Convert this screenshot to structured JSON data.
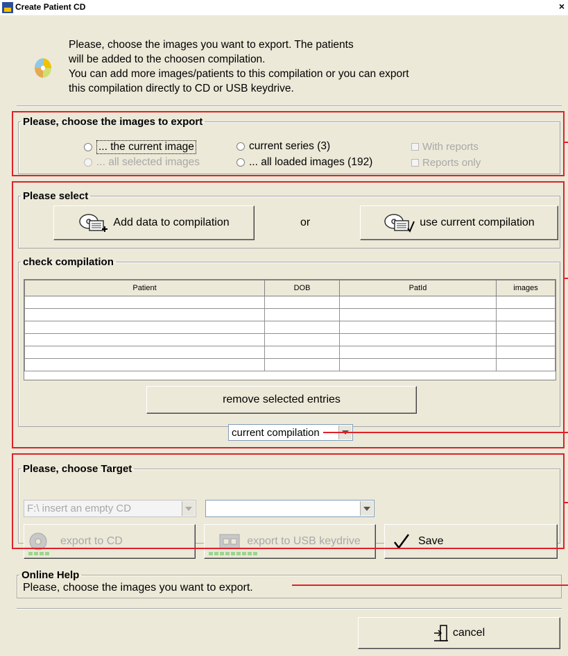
{
  "window": {
    "title": "Create Patient CD",
    "close_label": "×"
  },
  "intro": {
    "lines": [
      "Please, choose the images you want to export. The patients",
      "will be added to the choosen compilation.",
      "You can add more images/patients to this compilation or you can export",
      "this compilation directly to CD or USB keydrive."
    ]
  },
  "choose_images": {
    "legend": "Please, choose the images to export",
    "current_image": "... the current image",
    "current_series": "current series (3)",
    "with_reports": "With reports",
    "all_selected": "... all selected images",
    "all_loaded": "... all loaded images (192)",
    "reports_only": "Reports only"
  },
  "please_select": {
    "legend": "Please select",
    "add_button": "Add data to compilation",
    "or_label": "or",
    "use_button": "use current compilation"
  },
  "check_compilation": {
    "legend": "check compilation",
    "columns": [
      "Patient",
      "DOB",
      "PatId",
      "images"
    ],
    "rows": [
      [
        "",
        "",
        "",
        ""
      ],
      [
        "",
        "",
        "",
        ""
      ],
      [
        "",
        "",
        "",
        ""
      ],
      [
        "",
        "",
        "",
        ""
      ],
      [
        "",
        "",
        "",
        ""
      ],
      [
        "",
        "",
        "",
        ""
      ]
    ],
    "remove_button": "remove selected entries",
    "compilation_select": "current compilation"
  },
  "target": {
    "legend": "Please, choose Target",
    "drive_select": "F:\\  insert an empty CD",
    "second_select": "",
    "export_cd": "export to CD",
    "export_usb": "export to USB keydrive",
    "save": "Save",
    "cd_progress_segments": 4,
    "usb_progress_segments": 9
  },
  "online_help": {
    "legend": "Online Help",
    "text": "Please, choose the images you want to export."
  },
  "footer": {
    "cancel": "cancel"
  },
  "colors": {
    "annotation_red": "#e0202a",
    "window_bg": "#ece9d8",
    "progress_green": "#9bd68c"
  }
}
